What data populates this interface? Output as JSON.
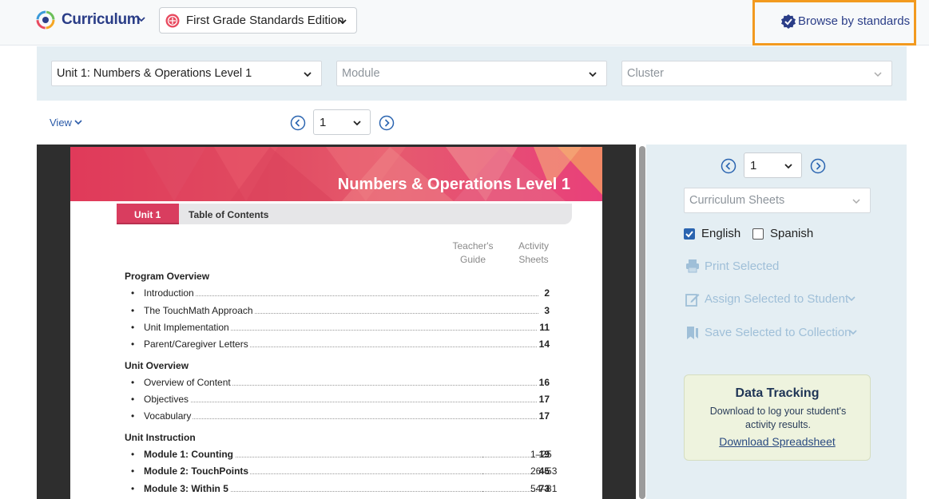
{
  "header": {
    "brand": "Curriculum",
    "edition": "First Grade Standards Edition",
    "browse_label": "Browse by standards",
    "accent": "#f29a1f",
    "brand_color": "#2a3d87"
  },
  "filters": {
    "unit": "Unit 1: Numbers & Operations Level 1",
    "module_placeholder": "Module",
    "cluster_placeholder": "Cluster"
  },
  "viewer_controls": {
    "view_label": "View",
    "page": "1"
  },
  "document": {
    "banner_title": "Numbers & Operations Level 1",
    "unit_tab": "Unit 1",
    "toc_title": "Table of Contents",
    "col_teacher": [
      "Teacher's",
      "Guide"
    ],
    "col_activity": [
      "Activity",
      "Sheets"
    ],
    "sections": [
      {
        "heading": "Program Overview",
        "items": [
          {
            "title": "Introduction",
            "page": "2"
          },
          {
            "title": "The TouchMath Approach",
            "page": "3"
          },
          {
            "title": "Unit Implementation",
            "page": "11"
          },
          {
            "title": "Parent/Caregiver Letters",
            "page": "14"
          }
        ]
      },
      {
        "heading": "Unit Overview",
        "items": [
          {
            "title": "Overview of Content",
            "page": "16"
          },
          {
            "title": "Objectives",
            "page": "17"
          },
          {
            "title": "Vocabulary",
            "page": "17"
          }
        ]
      },
      {
        "heading": "Unit Instruction",
        "items": [
          {
            "title": "Module 1: Counting",
            "page": "19",
            "sheets": "1–25"
          },
          {
            "title": "Module 2: TouchPoints",
            "page": "45",
            "sheets": "26–53"
          },
          {
            "title": "Module 3: Within 5",
            "page": "73",
            "sheets": "54–81"
          }
        ]
      }
    ]
  },
  "panel": {
    "page": "1",
    "sheets_placeholder": "Curriculum Sheets",
    "english_label": "English",
    "english_checked": true,
    "spanish_label": "Spanish",
    "spanish_checked": false,
    "print_label": "Print Selected",
    "assign_label": "Assign Selected to Student",
    "save_label": "Save Selected to Collection",
    "tracking": {
      "title": "Data Tracking",
      "description": "Download to log your student's activity results.",
      "link": "Download Spreadsheet"
    }
  },
  "icons": [
    "curriculum-logo-icon",
    "chevron-down-icon",
    "edition-badge-icon",
    "verified-badge-icon",
    "chevron-left-circle-icon",
    "chevron-right-circle-icon",
    "printer-icon",
    "assign-pencil-icon",
    "bookmark-stack-icon"
  ]
}
